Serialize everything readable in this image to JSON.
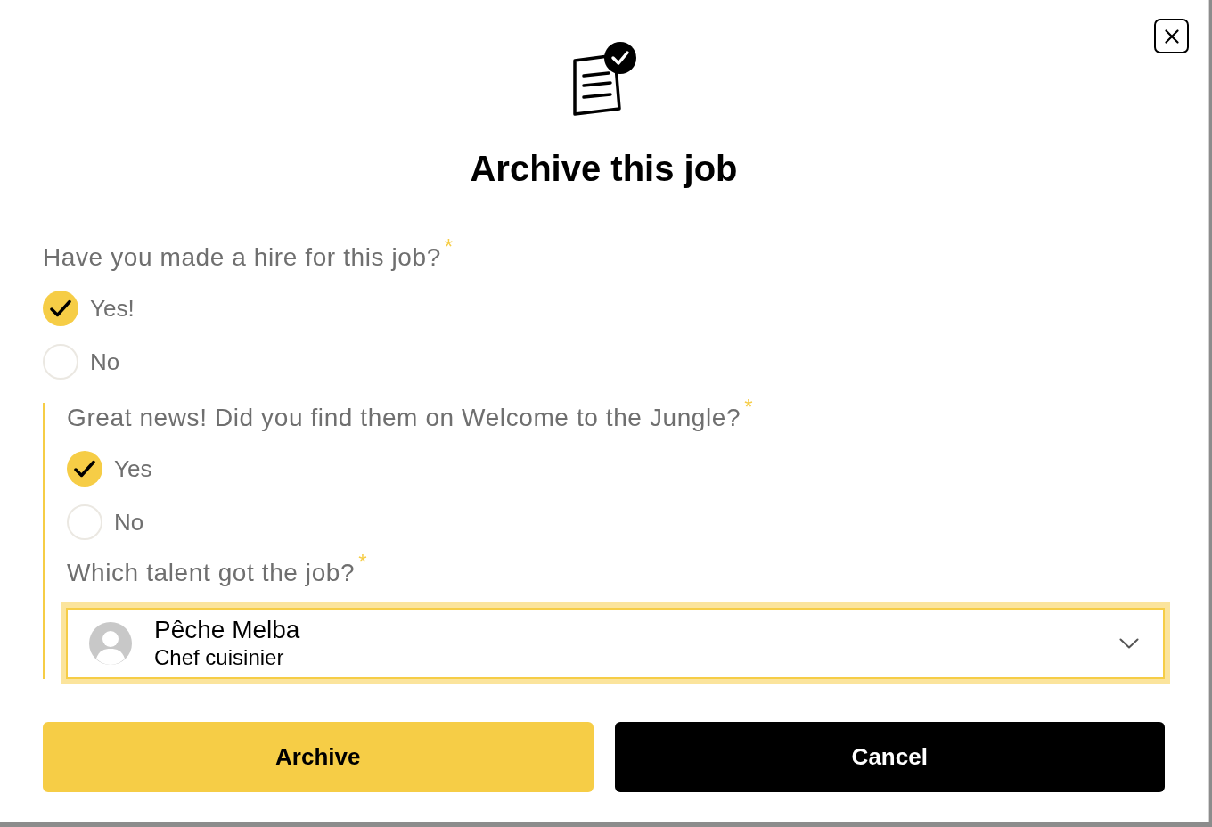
{
  "dialog": {
    "title": "Archive this job"
  },
  "questions": [
    {
      "kind": "radio",
      "label": "Have you made a hire for this job?",
      "required_mark": "*",
      "options": [
        {
          "label": "Yes!",
          "selected": true
        },
        {
          "label": "No",
          "selected": false
        }
      ],
      "follow_up": [
        {
          "kind": "radio",
          "label": "Great news! Did you find them on Welcome to the Jungle?",
          "required_mark": "*",
          "options": [
            {
              "label": "Yes",
              "selected": true
            },
            {
              "label": "No",
              "selected": false
            }
          ]
        },
        {
          "kind": "select",
          "label": "Which talent got the job?",
          "required_mark": "*",
          "focused": true,
          "value": {
            "name": "Pêche Melba",
            "subtitle": "Chef cuisinier"
          }
        }
      ]
    }
  ],
  "buttons": [
    {
      "label": "Archive",
      "kind": "primary"
    },
    {
      "label": "Cancel",
      "kind": "secondary"
    }
  ]
}
